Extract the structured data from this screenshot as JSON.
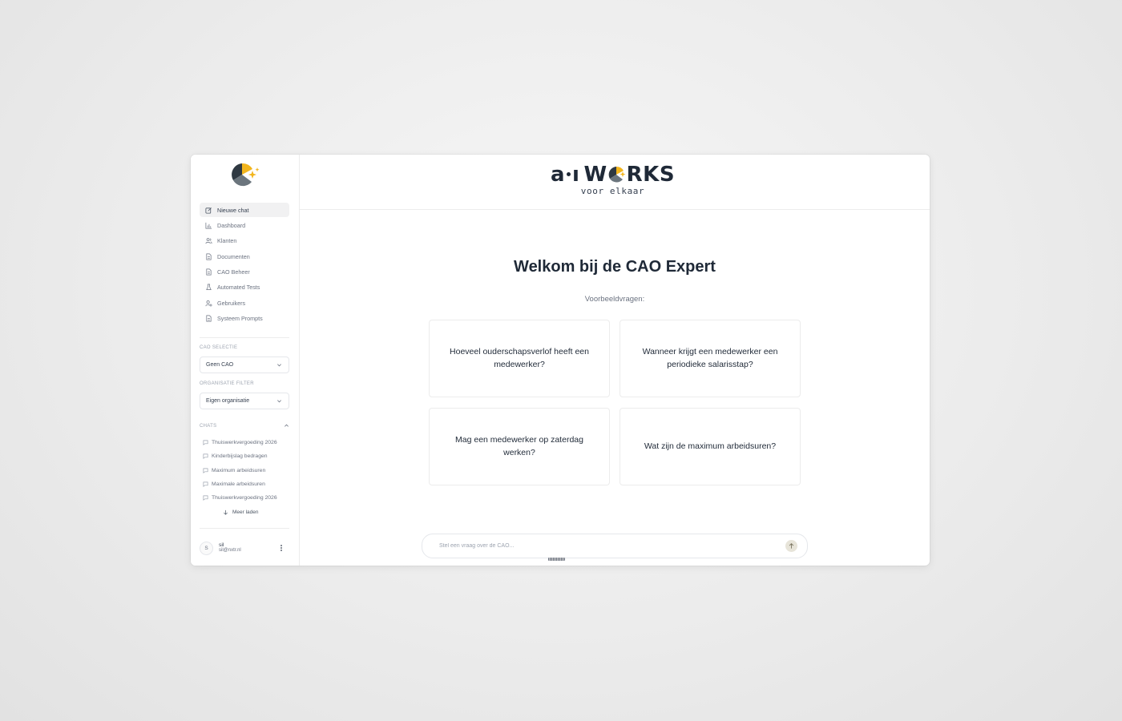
{
  "sidebar": {
    "logo_icon": "app-logo-icon",
    "nav": [
      {
        "label": "Nieuwe chat",
        "icon": "edit-icon",
        "active": true
      },
      {
        "label": "Dashboard",
        "icon": "bar-chart-icon"
      },
      {
        "label": "Klanten",
        "icon": "users-icon"
      },
      {
        "label": "Documenten",
        "icon": "document-icon"
      },
      {
        "label": "CAO Beheer",
        "icon": "document-icon"
      },
      {
        "label": "Automated Tests",
        "icon": "flask-icon"
      },
      {
        "label": "Gebruikers",
        "icon": "user-cog-icon"
      },
      {
        "label": "Systeem Prompts",
        "icon": "document-icon"
      }
    ],
    "cao_selectie": {
      "label": "CAO SELECTIE",
      "value": "Geen CAO"
    },
    "organisatie_filter": {
      "label": "ORGANISATIE FILTER",
      "value": "Eigen organisatie"
    },
    "chats": {
      "label": "CHATS",
      "items": [
        "Thuiswerkvergoeding 2026",
        "Kinderbijslag bedragen",
        "Maximum arbeidsuren",
        "Maximale arbeidsuren",
        "Thuiswerkvergoeding 2026"
      ],
      "more_label": "Meer laden"
    },
    "user": {
      "initial": "S",
      "name": "sil",
      "email": "sil@nxtr.nl"
    }
  },
  "header": {
    "brand_ai": "a",
    "brand_i": "ı",
    "brand_works_1": "W",
    "brand_works_2": "RKS",
    "brand_sub": "voor elkaar"
  },
  "main": {
    "welcome": "Welkom bij de CAO Expert",
    "examples_label": "Voorbeeldvragen:",
    "examples": [
      "Hoeveel ouderschapsverlof heeft een medewerker?",
      "Wanneer krijgt een medewerker een periodieke salarisstap?",
      "Mag een medewerker op zaterdag werken?",
      "Wat zijn de maximum arbeidsuren?"
    ],
    "input_placeholder": "Stel een vraag over de CAO..."
  },
  "colors": {
    "brand_yellow": "#f2b51d",
    "brand_dark": "#2f3942",
    "brand_gray": "#8a949c"
  }
}
